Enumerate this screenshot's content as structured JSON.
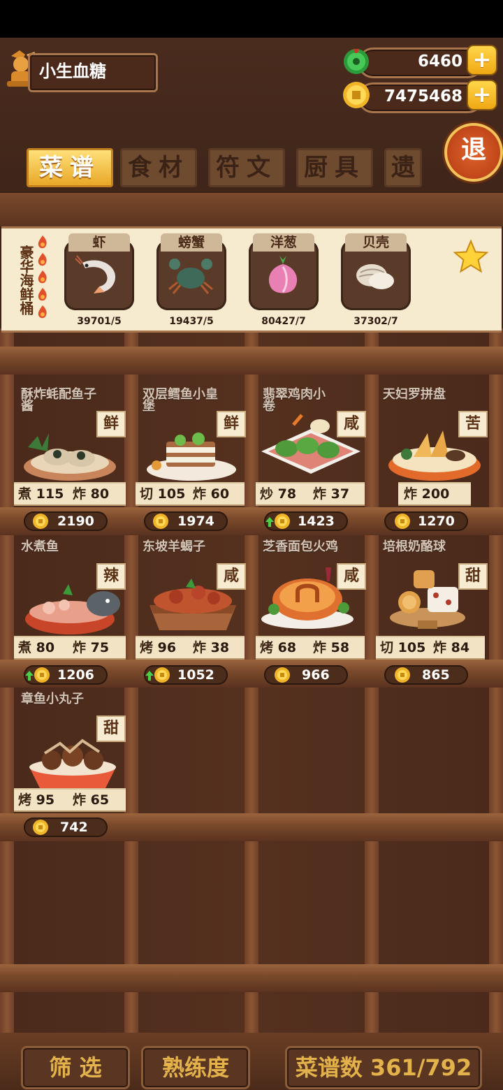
{
  "player": {
    "name": "小生血糖"
  },
  "currency": {
    "jade": "6460",
    "coins": "7475468",
    "plus_label": "+"
  },
  "exit_label": "退",
  "tabs": [
    {
      "label": "菜谱",
      "active": true
    },
    {
      "label": "食材",
      "active": false
    },
    {
      "label": "符文",
      "active": false
    },
    {
      "label": "厨具",
      "active": false
    },
    {
      "label": "遗",
      "active": false
    }
  ],
  "ingredient_bar": {
    "title": "豪华海鲜桶",
    "items": [
      {
        "name": "虾",
        "count": "39701/5",
        "icon": "shrimp-icon"
      },
      {
        "name": "螃蟹",
        "count": "19437/5",
        "icon": "crab-icon"
      },
      {
        "name": "洋葱",
        "count": "80427/7",
        "icon": "onion-icon"
      },
      {
        "name": "贝壳",
        "count": "37302/7",
        "icon": "shell-icon"
      }
    ]
  },
  "recipes": [
    {
      "title": "酥炸蚝配鱼子酱",
      "taste": "鲜",
      "s1": "煮",
      "v1": "115",
      "s2": "炸",
      "v2": "80",
      "price": "2190",
      "up": false
    },
    {
      "title": "双层鳕鱼小皇堡",
      "taste": "鲜",
      "s1": "切",
      "v1": "105",
      "s2": "炸",
      "v2": "60",
      "price": "1974",
      "up": false
    },
    {
      "title": "翡翠鸡肉小卷",
      "taste": "咸",
      "s1": "炒",
      "v1": "78",
      "s2": "炸",
      "v2": "37",
      "price": "1423",
      "up": true
    },
    {
      "title": "天妇罗拼盘",
      "taste": "苦",
      "s1": "",
      "v1": "",
      "s2": "炸",
      "v2": "200",
      "price": "1270",
      "up": false
    },
    {
      "title": "水煮鱼",
      "taste": "辣",
      "s1": "煮",
      "v1": "80",
      "s2": "炸",
      "v2": "75",
      "price": "1206",
      "up": true
    },
    {
      "title": "东坡羊蝎子",
      "taste": "咸",
      "s1": "烤",
      "v1": "96",
      "s2": "炸",
      "v2": "38",
      "price": "1052",
      "up": true
    },
    {
      "title": "芝香面包火鸡",
      "taste": "咸",
      "s1": "烤",
      "v1": "68",
      "s2": "炸",
      "v2": "58",
      "price": "966",
      "up": false
    },
    {
      "title": "培根奶酪球",
      "taste": "甜",
      "s1": "切",
      "v1": "105",
      "s2": "炸",
      "v2": "84",
      "price": "865",
      "up": false
    },
    {
      "title": "章鱼小丸子",
      "taste": "甜",
      "s1": "烤",
      "v1": "95",
      "s2": "炸",
      "v2": "65",
      "price": "742",
      "up": false
    }
  ],
  "bottom": {
    "filter_label": "筛 选",
    "proficiency_label": "熟练度",
    "recipe_count_label": "菜谱数 361/792"
  },
  "colors": {
    "accent": "#e8a828",
    "wood": "#5b3420",
    "gold_text": "#e4b24a"
  }
}
